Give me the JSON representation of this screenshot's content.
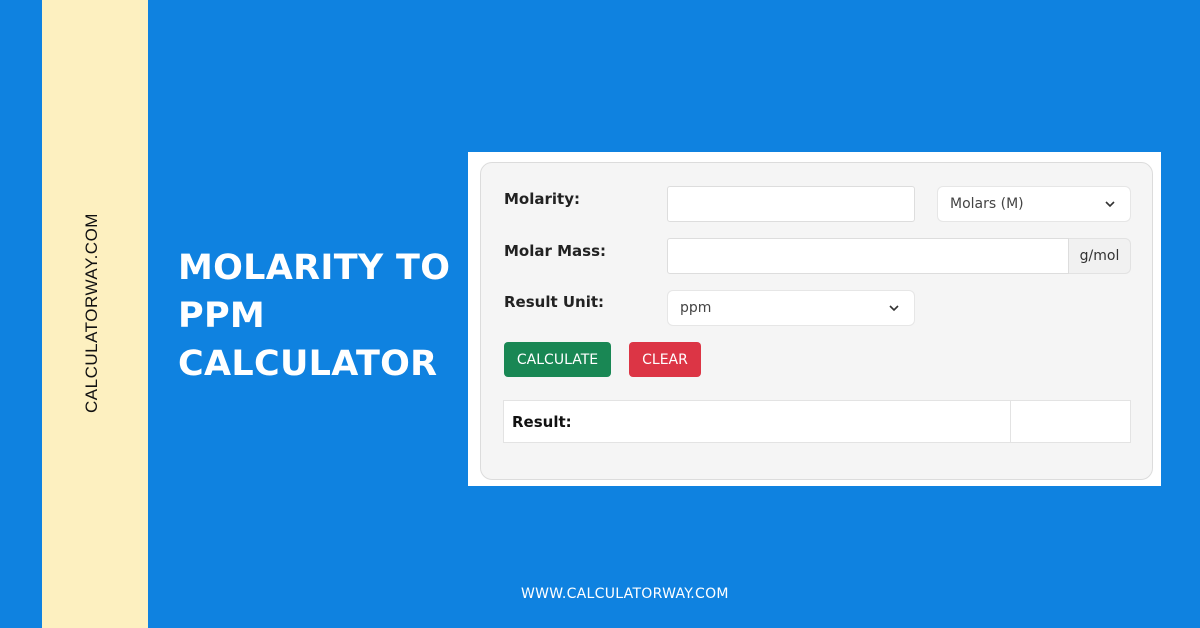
{
  "sidebar": {
    "brand_vertical": "CALCULATORWAY.COM"
  },
  "hero": {
    "title_lines": [
      "MOLARITY TO",
      "PPM",
      "CALCULATOR"
    ]
  },
  "footer": {
    "url": "WWW.CALCULATORWAY.COM"
  },
  "form": {
    "molarity": {
      "label": "Molarity:",
      "value": "",
      "unit_selected": "Molars (M)"
    },
    "molar_mass": {
      "label": "Molar Mass:",
      "value": "",
      "unit_addon": "g/mol"
    },
    "result_unit": {
      "label": "Result Unit:",
      "selected": "ppm"
    },
    "buttons": {
      "calculate": "CALCULATE",
      "clear": "CLEAR"
    },
    "result": {
      "label": "Result:",
      "value": ""
    }
  },
  "colors": {
    "background": "#0f82e0",
    "strip": "#fdf0c0",
    "calculate": "#198754",
    "clear": "#dc3545"
  }
}
